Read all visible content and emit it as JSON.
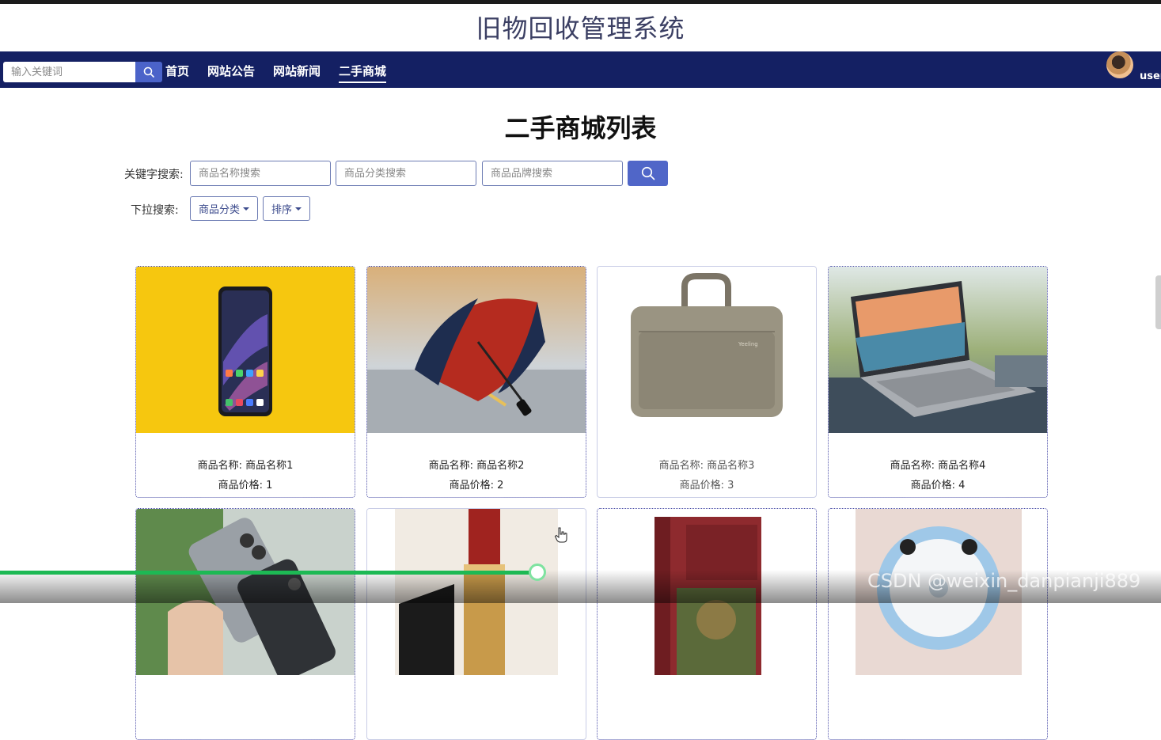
{
  "site": {
    "title": "旧物回收管理系统"
  },
  "nav": {
    "search_placeholder": "输入关键词",
    "items": [
      "首页",
      "网站公告",
      "网站新闻",
      "二手商城"
    ],
    "active_index": 3,
    "username": "user"
  },
  "page": {
    "heading": "二手商城列表"
  },
  "filters": {
    "keyword_label": "关键字搜索:",
    "name_placeholder": "商品名称搜索",
    "category_placeholder": "商品分类搜索",
    "brand_placeholder": "商品品牌搜索",
    "dropdown_label": "下拉搜索:",
    "category_dropdown": "商品分类",
    "sort_dropdown": "排序"
  },
  "products": [
    {
      "name": "商品名称: 商品名称1",
      "price": "商品价格: 1",
      "image": "smartphone"
    },
    {
      "name": "商品名称: 商品名称2",
      "price": "商品价格: 2",
      "image": "umbrella"
    },
    {
      "name": "商品名称: 商品名称3",
      "price": "商品价格: 3",
      "image": "laptop-bag"
    },
    {
      "name": "商品名称: 商品名称4",
      "price": "商品价格: 4",
      "image": "laptop"
    },
    {
      "image": "phones-in-hand"
    },
    {
      "image": "lipstick"
    },
    {
      "image": "book"
    },
    {
      "image": "desk-fan"
    }
  ],
  "video": {
    "progress": 0.463
  },
  "watermark": "CSDN @weixin_danpianji889",
  "colors": {
    "nav": "#142063",
    "accent": "#4b63c9",
    "progress": "#1db954"
  }
}
